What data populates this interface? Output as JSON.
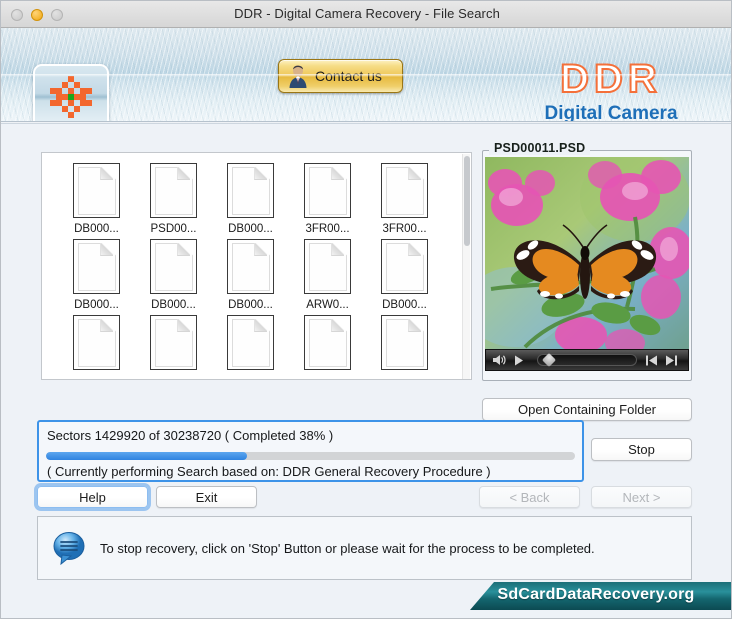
{
  "window": {
    "title": "DDR - Digital Camera Recovery - File Search",
    "controls": [
      "close",
      "minimize",
      "maximize"
    ]
  },
  "header": {
    "logo_icon": "checkered-flower-logo",
    "contact_button": "Contact us",
    "contact_icon": "person-icon",
    "brand_title": "DDR",
    "brand_subtitle": "Digital Camera",
    "brand_color": "#f4703a",
    "brand_subtitle_color": "#1e6fb8"
  },
  "file_list": {
    "files": [
      {
        "name": "DB000...",
        "icon": "document-icon"
      },
      {
        "name": "PSD00...",
        "icon": "document-icon"
      },
      {
        "name": "DB000...",
        "icon": "document-icon"
      },
      {
        "name": "3FR00...",
        "icon": "document-icon"
      },
      {
        "name": "3FR00...",
        "icon": "document-icon"
      },
      {
        "name": "DB000...",
        "icon": "document-icon"
      },
      {
        "name": "DB000...",
        "icon": "document-icon"
      },
      {
        "name": "DB000...",
        "icon": "document-icon"
      },
      {
        "name": "ARW0...",
        "icon": "document-icon"
      },
      {
        "name": "DB000...",
        "icon": "document-icon"
      },
      {
        "name": "",
        "icon": "document-icon"
      },
      {
        "name": "",
        "icon": "document-icon"
      },
      {
        "name": "",
        "icon": "document-icon"
      },
      {
        "name": "",
        "icon": "document-icon"
      },
      {
        "name": "",
        "icon": "document-icon"
      }
    ]
  },
  "preview": {
    "file_name": "PSD00011.PSD",
    "image_description": "butterfly-on-pink-flowers",
    "media_controls": [
      {
        "icon": "volume-icon"
      },
      {
        "icon": "play-icon"
      },
      {
        "icon": "seek-slider"
      },
      {
        "icon": "step-back-icon"
      },
      {
        "icon": "step-forward-icon"
      }
    ]
  },
  "actions": {
    "open_folder": "Open Containing Folder",
    "stop": "Stop",
    "help": "Help",
    "exit": "Exit",
    "back": "< Back",
    "next": "Next >"
  },
  "progress": {
    "status_line": "Sectors 1429920 of 30238720    ( Completed  38% )",
    "sectors_done": 1429920,
    "sectors_total": 30238720,
    "percent": 38,
    "detail_line": "( Currently performing Search based on: DDR General Recovery Procedure )",
    "accent_color": "#3d93e8"
  },
  "info": {
    "icon": "speech-bubble-icon",
    "message": "To stop recovery, click on 'Stop' Button or please wait for the process to be completed."
  },
  "footer": {
    "site": "SdCardDataRecovery.org",
    "banner_color": "#1c6f78"
  }
}
